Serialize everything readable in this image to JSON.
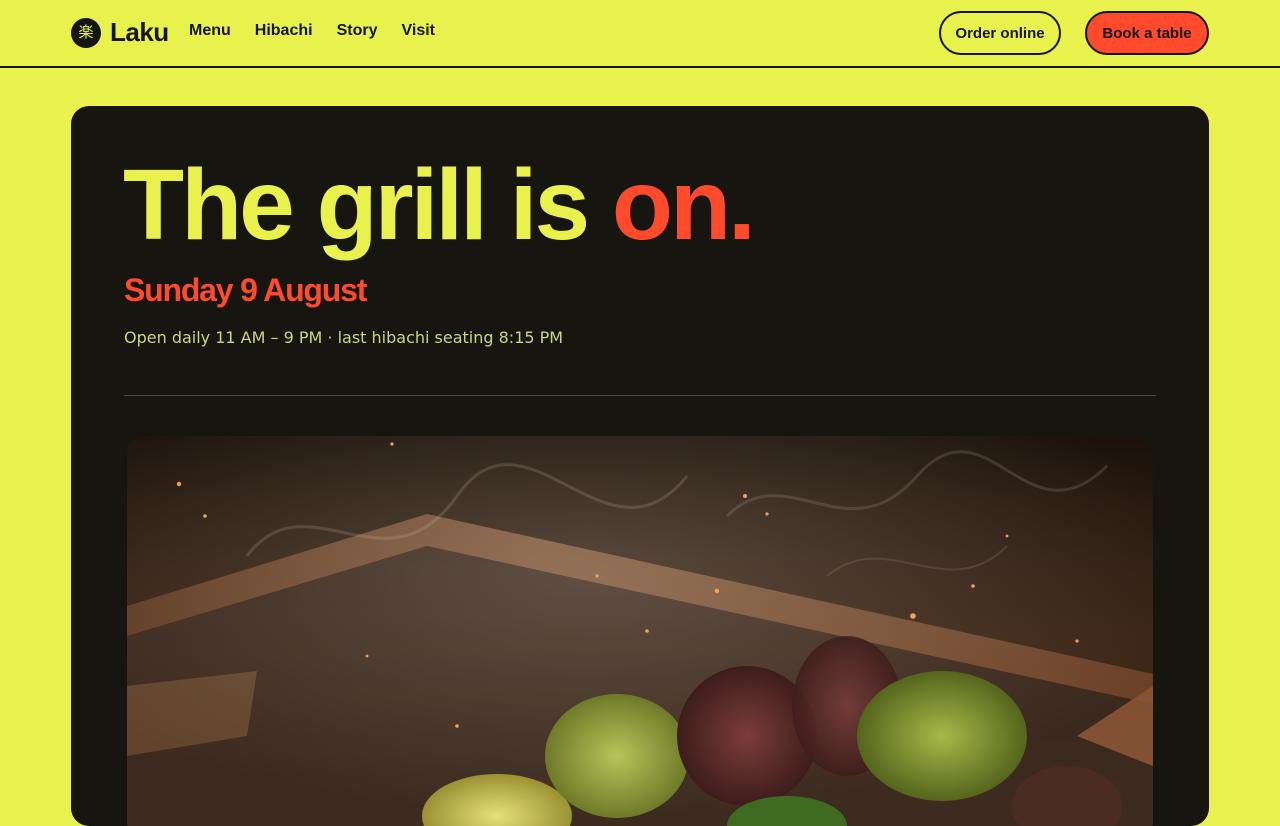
{
  "brand": {
    "mark": "楽",
    "name": "Laku",
    "mark_icon": "kanji-logo-icon"
  },
  "nav": {
    "items": [
      {
        "label": "Menu"
      },
      {
        "label": "Hibachi"
      },
      {
        "label": "Story"
      },
      {
        "label": "Visit"
      }
    ]
  },
  "actions": {
    "order_label": "Order online",
    "book_label": "Book a table"
  },
  "hero": {
    "headline_main": "The grill is ",
    "headline_accent": "on.",
    "date": "Sunday 9 August",
    "hours": "Open daily 11 AM – 9 PM · last hibachi seating 8:15 PM"
  },
  "photo": {
    "icon": "hibachi-grill-photo"
  },
  "colors": {
    "background": "#e9f24d",
    "ink": "#17150f",
    "accent": "#ff4b2b",
    "headline": "#e9f24d"
  }
}
